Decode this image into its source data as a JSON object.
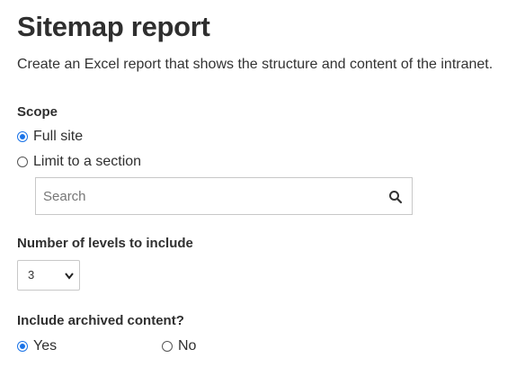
{
  "page": {
    "title": "Sitemap report",
    "description": "Create an Excel report that shows the structure and content of the intranet."
  },
  "scope": {
    "label": "Scope",
    "options": [
      {
        "label": "Full site",
        "selected": true
      },
      {
        "label": "Limit to a section",
        "selected": false
      }
    ],
    "search": {
      "placeholder": "Search",
      "value": "",
      "icon": "search-icon"
    }
  },
  "levels": {
    "label": "Number of levels to include",
    "selected": "3",
    "icon": "chevron-down-icon"
  },
  "archived": {
    "label": "Include archived content?",
    "options": [
      {
        "label": "Yes",
        "selected": true
      },
      {
        "label": "No",
        "selected": false
      }
    ]
  },
  "colors": {
    "accent": "#1a73e8",
    "border": "#c8c8c8",
    "text": "#2f2f2f"
  }
}
